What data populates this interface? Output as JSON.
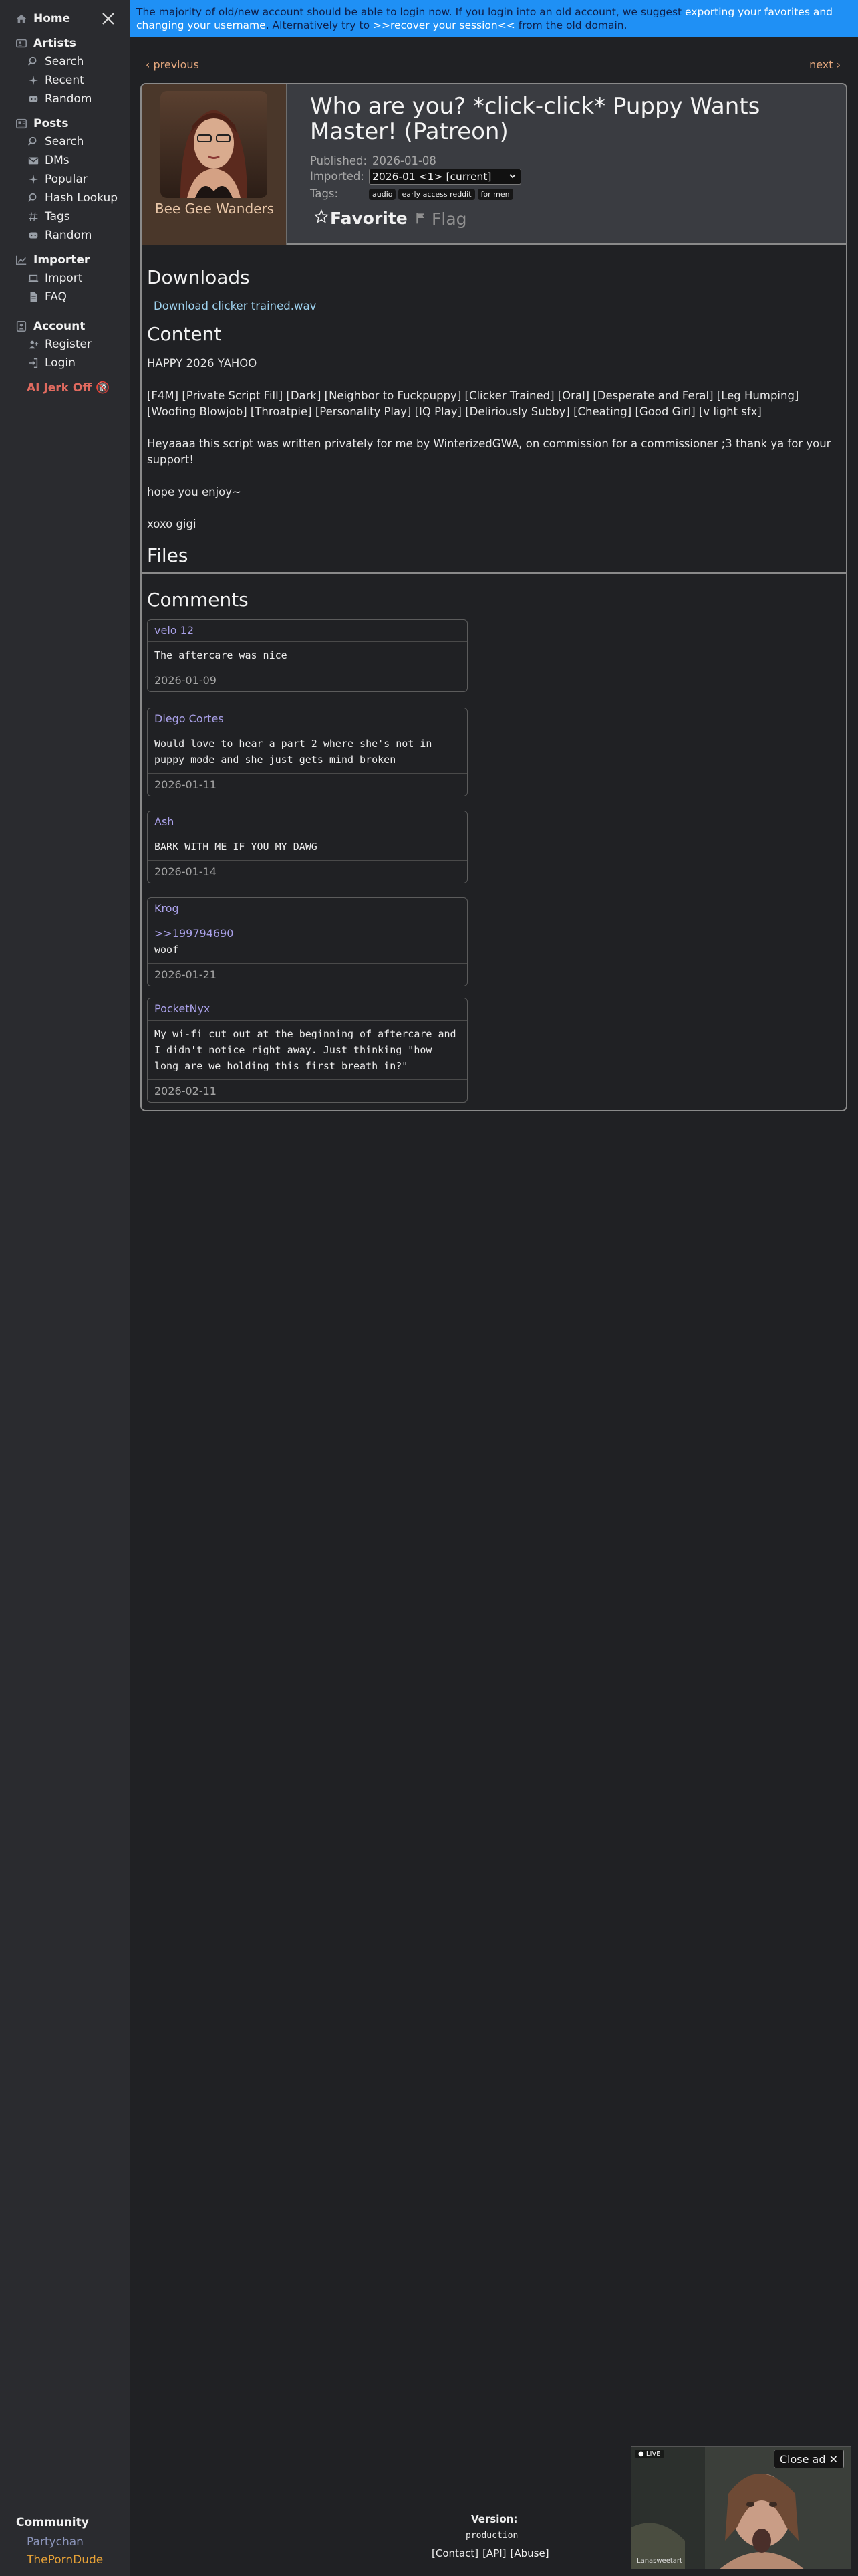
{
  "sidebar": {
    "home": "Home",
    "sections": [
      {
        "label": "Artists",
        "items": [
          "Search",
          "Recent",
          "Random"
        ]
      },
      {
        "label": "Posts",
        "items": [
          "Search",
          "DMs",
          "Popular",
          "Hash Lookup",
          "Tags",
          "Random"
        ]
      },
      {
        "label": "Importer",
        "items": [
          "Import",
          "FAQ"
        ]
      },
      {
        "label": "Account",
        "items": [
          "Register",
          "Login"
        ]
      }
    ],
    "ai_link": "AI Jerk Off 🔞",
    "community": "Community",
    "community_links": [
      "Partychan",
      "ThePornDude"
    ]
  },
  "banner": {
    "text1": "The majority of old/new account should be able to login now. If you login into an old account, we suggest ",
    "link1": "exporting your favorites and changing your username",
    "text2": ". Alternatively try to ",
    "link2": ">>recover your session<<",
    "text3": " from the old domain."
  },
  "nav": {
    "previous": "‹ previous",
    "next": "next ›"
  },
  "post": {
    "artist": "Bee Gee Wanders",
    "title": "Who are you? *click-click* Puppy Wants Master! (Patreon)",
    "published_label": "Published:",
    "published": "2026-01-08",
    "imported_label": "Imported:",
    "imported": "2026-01 <1> [current]",
    "tags_label": "Tags:",
    "tags": [
      "audio",
      "early access reddit",
      "for men"
    ],
    "favorite": "Favorite",
    "flag": "Flag",
    "downloads_heading": "Downloads",
    "download_link": "Download clicker trained.wav",
    "content_heading": "Content",
    "content": [
      "HAPPY 2026 YAHOO",
      "[F4M] [Private Script Fill] [Dark] [Neighbor to Fuckpuppy] [Clicker Trained] [Oral] [Desperate and Feral] [Leg Humping] [Woofing Blowjob] [Throatpie] [Personality Play] [IQ Play] [Deliriously Subby] [Cheating] [Good Girl] [v light sfx]",
      "Heyaaaa this script was written privately for me by WinterizedGWA, on commission for a commissioner ;3 thank ya for your support!",
      "hope you enjoy~",
      "xoxo gigi"
    ],
    "files_heading": "Files",
    "comments_heading": "Comments"
  },
  "comments": [
    {
      "author": "velo 12",
      "body": "The aftercare was nice",
      "date": "2026-01-09"
    },
    {
      "author": "Diego Cortes",
      "body": "Would love to hear a part 2 where she's not in puppy mode and she just gets mind broken",
      "date": "2026-01-11"
    },
    {
      "author": "Ash",
      "body": "BARK WITH ME IF YOU MY DAWG",
      "date": "2026-01-14"
    },
    {
      "author": "Krog",
      "reply": ">>199794690",
      "body": "woof",
      "date": "2026-01-21"
    },
    {
      "author": "PocketNyx",
      "body": "My wi-fi cut out at the beginning of aftercare and I didn't notice right away. Just thinking \"how long are we holding this first breath in?\"",
      "date": "2026-02-11"
    }
  ],
  "footer": {
    "version_label": "Version:",
    "version": "production",
    "links": [
      "[Contact]",
      "[API]",
      "[Abuse]"
    ]
  },
  "ad": {
    "close": "Close ad ✕",
    "live": "● LIVE",
    "user": "Lanasweetart"
  }
}
